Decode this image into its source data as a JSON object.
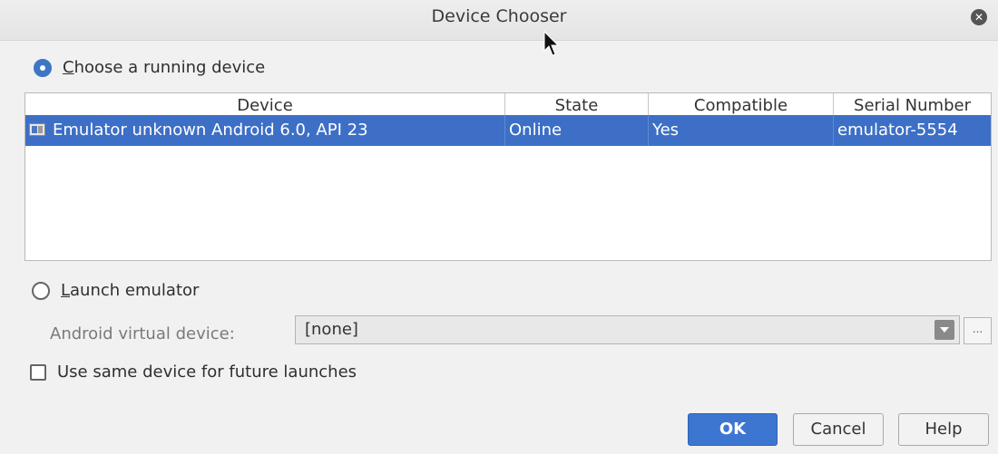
{
  "window": {
    "title": "Device Chooser"
  },
  "running": {
    "label_mnemonic": "C",
    "label_rest": "hoose a running device",
    "selected": true
  },
  "table": {
    "columns": [
      "Device",
      "State",
      "Compatible",
      "Serial Number"
    ],
    "rows": [
      {
        "device": "Emulator unknown Android 6.0, API 23",
        "state": "Online",
        "compatible": "Yes",
        "serial": "emulator-5554"
      }
    ]
  },
  "launch": {
    "label_mnemonic": "L",
    "label_rest": "aunch emulator",
    "selected": false
  },
  "avd": {
    "label": "Android virtual device:",
    "value": "[none]",
    "browse_label": "..."
  },
  "future": {
    "label": "Use same device for future launches",
    "checked": false
  },
  "buttons": {
    "ok": "OK",
    "cancel": "Cancel",
    "help": "Help"
  },
  "colors": {
    "accent": "#3d76d0",
    "selection": "#3d6fc6"
  },
  "icons": {
    "close": "close-icon",
    "device": "emulator-icon",
    "dropdown": "chevron-down-icon"
  }
}
